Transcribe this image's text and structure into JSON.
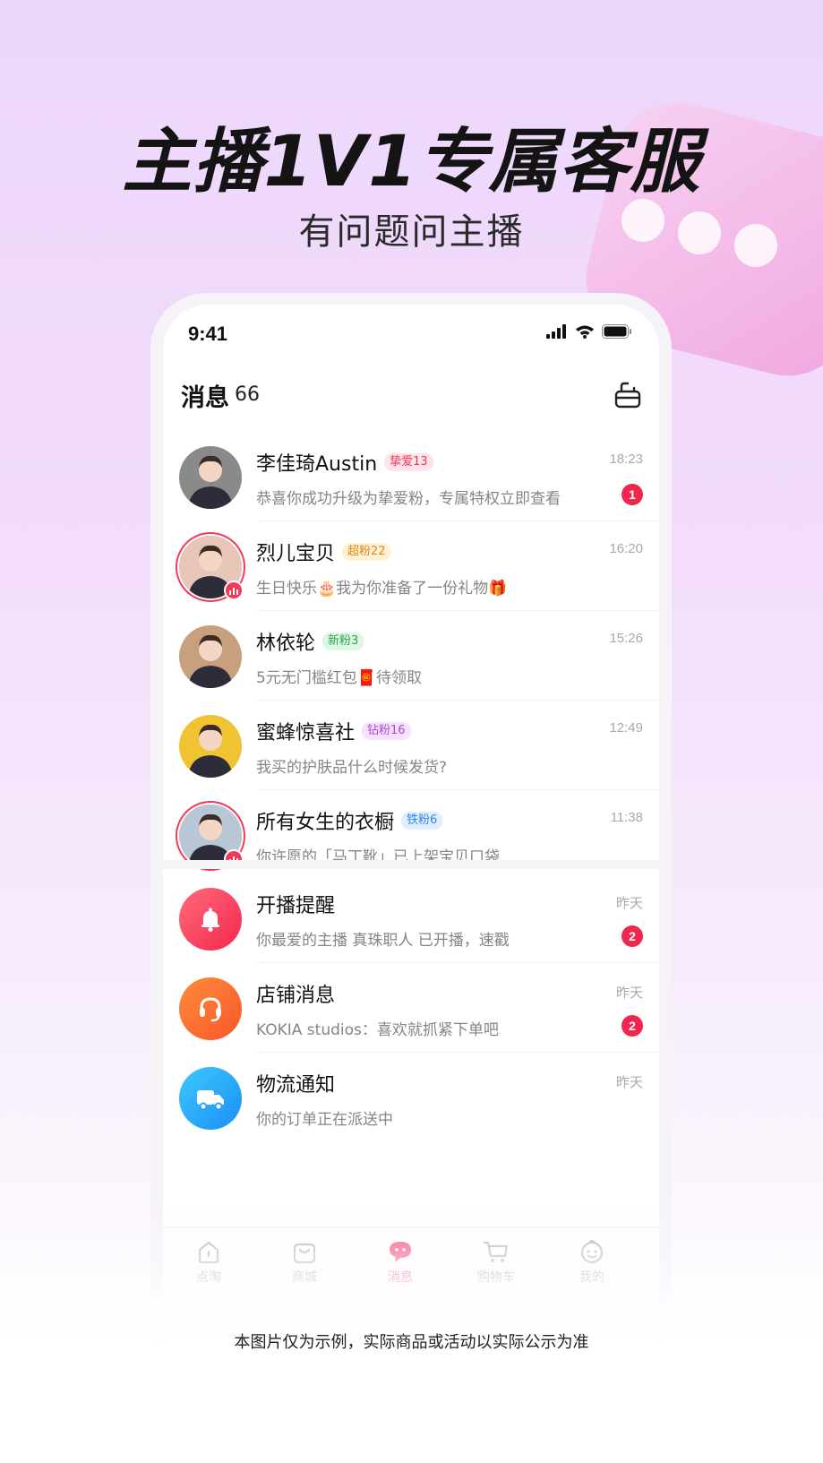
{
  "promo": {
    "headline": "主播1V1专属客服",
    "subheadline": "有问题问主播",
    "footnote": "本图片仅为示例，实际商品或活动以实际公示为准"
  },
  "status_bar": {
    "time": "9:41"
  },
  "header": {
    "title": "消息",
    "count": "66",
    "settings_icon": "settings-box-icon"
  },
  "conversations": [
    {
      "name": "李佳琦Austin",
      "fan_tag": "挚爱13",
      "tag_color": "#f0385a",
      "tag_bg": "#ffe3ea",
      "preview": "恭喜你成功升级为挚爱粉，专属特权立即查看",
      "time": "18:23",
      "unread": "1",
      "live": false,
      "avatar_color": "#8a8a8a"
    },
    {
      "name": "烈儿宝贝",
      "fan_tag": "超粉22",
      "tag_color": "#e08a12",
      "tag_bg": "#fff1d6",
      "preview": "生日快乐🎂我为你准备了一份礼物🎁",
      "time": "16:20",
      "unread": "",
      "live": true,
      "avatar_color": "#e7c6b8"
    },
    {
      "name": "林依轮",
      "fan_tag": "新粉3",
      "tag_color": "#2aa64f",
      "tag_bg": "#dff6e5",
      "preview": "5元无门槛红包🧧待领取",
      "time": "15:26",
      "unread": "",
      "live": false,
      "avatar_color": "#c9a07d"
    },
    {
      "name": "蜜蜂惊喜社",
      "fan_tag": "钻粉16",
      "tag_color": "#b245e0",
      "tag_bg": "#f5e3fd",
      "preview": "我买的护肤品什么时候发货?",
      "time": "12:49",
      "unread": "",
      "live": false,
      "avatar_color": "#f1c232"
    },
    {
      "name": "所有女生的衣橱",
      "fan_tag": "铁粉6",
      "tag_color": "#2f86e8",
      "tag_bg": "#e0eefd",
      "preview": "你许愿的「马丁靴」已上架宝贝口袋",
      "time": "11:38",
      "unread": "",
      "live": true,
      "avatar_color": "#b9c6d6"
    }
  ],
  "system_messages": [
    {
      "title": "开播提醒",
      "preview": "你最爱的主播 真珠职人 已开播，速戳",
      "time": "昨天",
      "unread": "2",
      "icon": "bell-icon",
      "color_from": "#ff6b7d",
      "color_to": "#f5264d"
    },
    {
      "title": "店铺消息",
      "preview": "KOKIA studios：喜欢就抓紧下单吧",
      "time": "昨天",
      "unread": "2",
      "icon": "headset-icon",
      "color_from": "#ff8c3a",
      "color_to": "#f8562a"
    },
    {
      "title": "物流通知",
      "preview": "你的订单正在派送中",
      "time": "昨天",
      "unread": "",
      "icon": "truck-icon",
      "color_from": "#3ec8ff",
      "color_to": "#1a8ff5"
    }
  ],
  "tabbar": {
    "active_color": "#f2416a",
    "items": [
      {
        "label": "点淘",
        "icon": "home-icon"
      },
      {
        "label": "商城",
        "icon": "shopping-bag-icon"
      },
      {
        "label": "消息",
        "icon": "chat-bubble-icon"
      },
      {
        "label": "购物车",
        "icon": "cart-icon"
      },
      {
        "label": "我的",
        "icon": "profile-face-icon"
      }
    ]
  }
}
